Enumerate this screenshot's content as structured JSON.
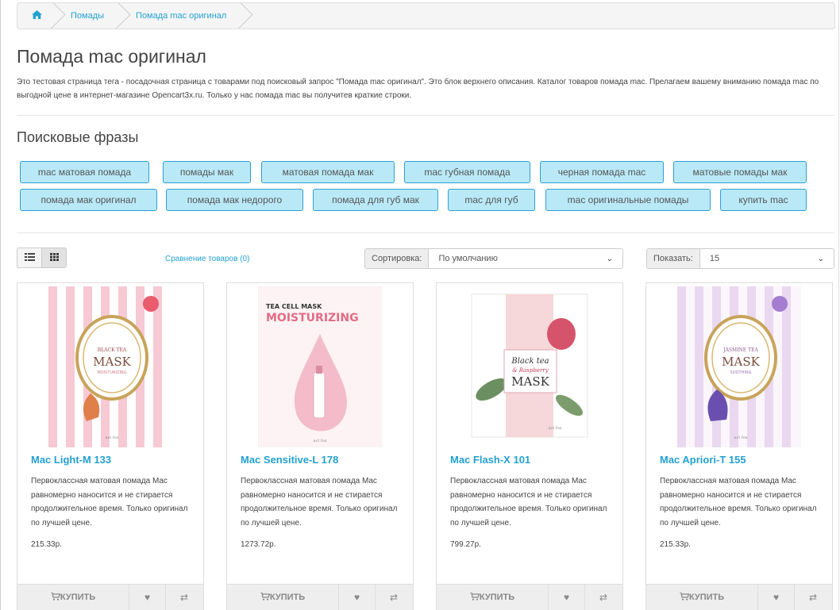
{
  "breadcrumb": [
    "Помады",
    "Помада mac оригинал"
  ],
  "page": {
    "title": "Помада mac оригинал",
    "description": "Это тестовая страница тега - посадочная страница с товарами под поисковый запрос \"Помада mac оригинал\". Это блок верхнего описания. Каталог товаров помада mac. Прелагаем вашему вниманию помада mac по выгодной цене в интернет-магазине Opencart3x.ru. Только у нас помада mac вы получитев краткие строки."
  },
  "search_phrases": {
    "title": "Поисковые фразы",
    "tags": [
      "mac матовая помада",
      "помады мак",
      "матовая помада мак",
      "mac губная помада",
      "черная помада mac",
      "матовые помады мак",
      "помада мак оригинал",
      "помада мак недорого",
      "помада для губ мак",
      "mac для губ",
      "mac оригинальные помады",
      "купить mac"
    ]
  },
  "toolbar": {
    "compare": "Сравнение товаров (0)",
    "sort_label": "Сортировка:",
    "sort_value": "По умолчанию",
    "limit_label": "Показать:",
    "limit_value": "15"
  },
  "products": [
    {
      "name": "Mac Light-M 133",
      "description": "Первоклассная матовая помада Mac равномерно наносится и не стирается продолжительное время. Только оригинал по лучшей цене.",
      "price": "215.33р.",
      "buy": "КУПИТЬ"
    },
    {
      "name": "Mac Sensitive-L 178",
      "description": "Первоклассная матовая помада Mac равномерно наносится и не стирается продолжительное время. Только оригинал по лучшей цене.",
      "price": "1273.72р.",
      "buy": "КУПИТЬ"
    },
    {
      "name": "Mac Flash-X 101",
      "description": "Первоклассная матовая помада Mac равномерно наносится и не стирается продолжительное время. Только оригинал по лучшей цене.",
      "price": "799.27р.",
      "buy": "КУПИТЬ"
    },
    {
      "name": "Mac Apriori-T 155",
      "description": "Первоклассная матовая помада Mac равномерно наносится и не стирается продолжительное время. Только оригинал по лучшей цене.",
      "price": "215.33р.",
      "buy": "КУПИТЬ"
    }
  ],
  "image_text": {
    "p1_brand": "BLACK TEA",
    "p1_title": "MASK",
    "p1_sub": "MOISTURIZING",
    "p2_top": "TEA CELL MASK",
    "p2_title": "MOISTURIZING",
    "p3_line1": "Black tea",
    "p3_line2": "& Raspberry",
    "p3_title": "MASK",
    "p4_brand": "JASMINE TEA",
    "p4_title": "MASK",
    "p4_sub": "SOOTHING",
    "maker": "act fox"
  },
  "colors": {
    "link": "#23a1d1",
    "tag_bg": "#b9e9f7",
    "tag_border": "#2d9fd4"
  }
}
